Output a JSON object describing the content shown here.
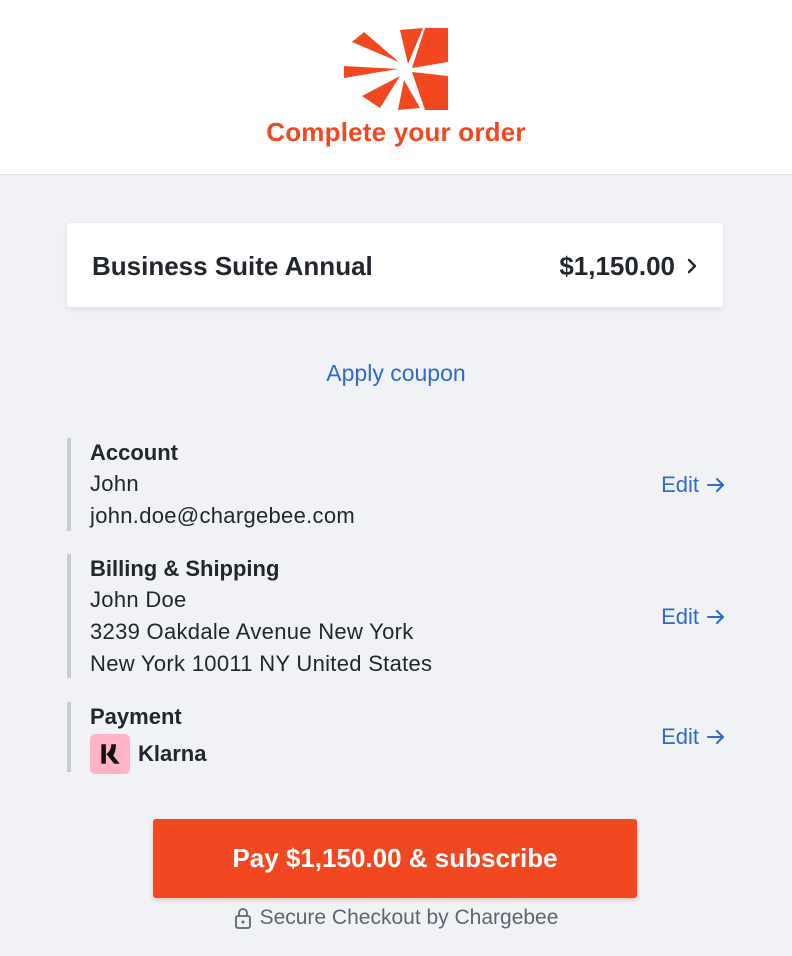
{
  "header": {
    "logo_icon": "chargebee-logo-icon",
    "title": "Complete your order",
    "accent_color": "#f24822"
  },
  "plan": {
    "name": "Business Suite Annual",
    "price": "$1,150.00",
    "chevron_icon": "chevron-right-icon"
  },
  "coupon": {
    "label": "Apply coupon"
  },
  "account": {
    "title": "Account",
    "name": "John",
    "email": "john.doe@chargebee.com",
    "edit_label": "Edit"
  },
  "billing": {
    "title": "Billing & Shipping",
    "name": "John Doe",
    "address_line1": "3239 Oakdale Avenue New York",
    "address_line2": "New York 10011 NY United States",
    "edit_label": "Edit"
  },
  "payment": {
    "title": "Payment",
    "method": "Klarna",
    "method_icon": "klarna-icon",
    "edit_label": "Edit"
  },
  "pay_button": {
    "label": "Pay $1,150.00 & subscribe"
  },
  "footer": {
    "secure_text": "Secure Checkout by Chargebee",
    "lock_icon": "lock-icon"
  }
}
